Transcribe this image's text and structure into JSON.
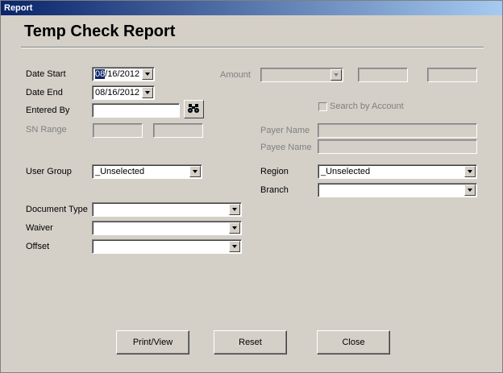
{
  "window": {
    "title": "Report"
  },
  "page": {
    "title": "Temp Check Report"
  },
  "form": {
    "date_start": {
      "label": "Date Start",
      "value_selected": "08",
      "value_rest": "/16/2012"
    },
    "date_end": {
      "label": "Date End",
      "value": "08/16/2012"
    },
    "entered_by": {
      "label": "Entered By",
      "value": ""
    },
    "sn_range": {
      "label": "SN Range",
      "from": "",
      "to": ""
    },
    "amount": {
      "label": "Amount",
      "operator": "",
      "value1": "",
      "value2": ""
    },
    "search_by_account": {
      "label": "Search by Account",
      "checked": false
    },
    "payer_name": {
      "label": "Payer Name",
      "value": ""
    },
    "payee_name": {
      "label": "Payee Name",
      "value": ""
    },
    "user_group": {
      "label": "User Group",
      "value": "_Unselected"
    },
    "region": {
      "label": "Region",
      "value": "_Unselected"
    },
    "branch": {
      "label": "Branch",
      "value": ""
    },
    "document_type": {
      "label": "Document Type",
      "value": ""
    },
    "waiver": {
      "label": "Waiver",
      "value": ""
    },
    "offset": {
      "label": "Offset",
      "value": ""
    }
  },
  "buttons": {
    "print": "Print/View",
    "reset": "Reset",
    "close": "Close"
  },
  "icons": {
    "find": "binoculars-icon"
  }
}
